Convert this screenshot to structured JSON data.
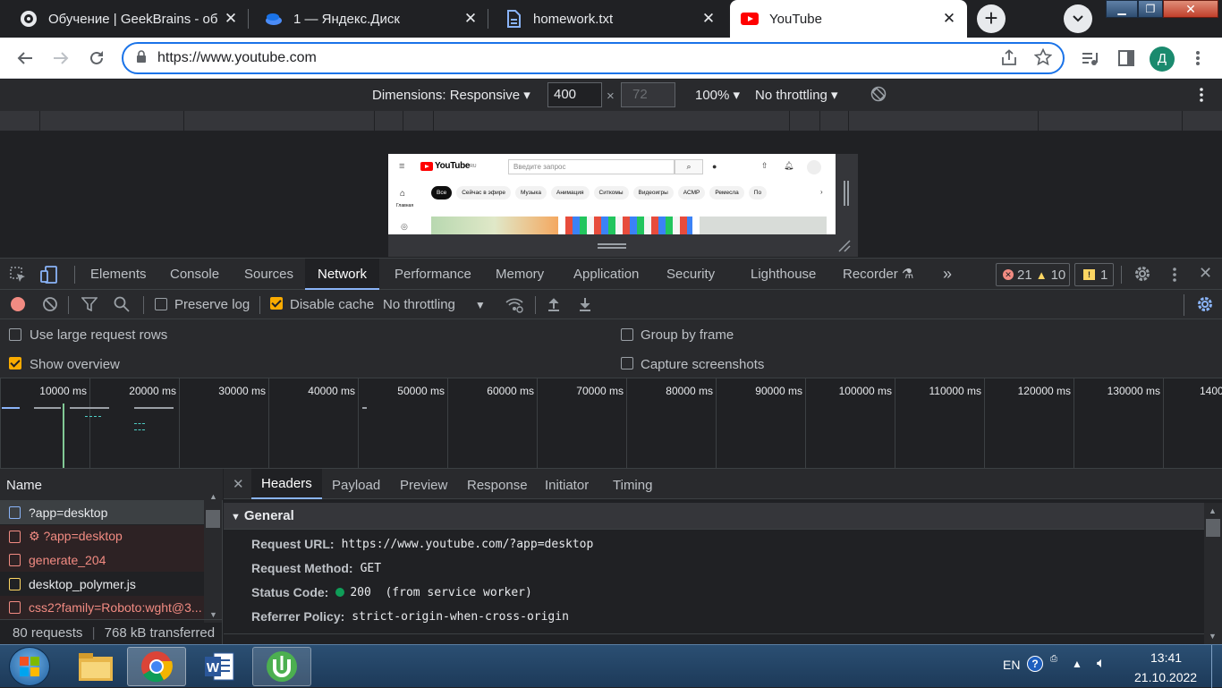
{
  "browser": {
    "tabs": [
      {
        "title": "Обучение | GeekBrains - об",
        "icon": "geekbrains-icon"
      },
      {
        "title": "1 — Яндекс.Диск",
        "icon": "yandex-disk-icon"
      },
      {
        "title": "homework.txt",
        "icon": "document-icon"
      },
      {
        "title": "YouTube",
        "icon": "youtube-icon"
      }
    ],
    "url": "https://www.youtube.com",
    "profile_letter": "Д"
  },
  "device_toolbar": {
    "dimensions": "Dimensions: Responsive",
    "width": "400",
    "height_placeholder": "72",
    "times": "×",
    "zoom": "100%",
    "throttling": "No throttling"
  },
  "preview": {
    "logo": "YouTube",
    "logo_sup": "RU",
    "search_placeholder": "Введите запрос",
    "home_label": "Главная",
    "chips": [
      "Все",
      "Сейчас в эфире",
      "Музыка",
      "Анимация",
      "Ситкомы",
      "Видеоигры",
      "АСМР",
      "Ремесла",
      "По"
    ]
  },
  "devtools": {
    "tabs": [
      "Elements",
      "Console",
      "Sources",
      "Network",
      "Performance",
      "Memory",
      "Application",
      "Security",
      "Lighthouse",
      "Recorder"
    ],
    "more": "»",
    "errors": "21",
    "warnings": "10",
    "issues": "1",
    "network_toolbar": {
      "preserve_log": "Preserve log",
      "disable_cache": "Disable cache",
      "throttling": "No throttling"
    },
    "settings": {
      "large_rows": "Use large request rows",
      "show_overview": "Show overview",
      "group_by_frame": "Group by frame",
      "capture_screenshots": "Capture screenshots"
    },
    "timeline_ticks": [
      "10000 ms",
      "20000 ms",
      "30000 ms",
      "40000 ms",
      "50000 ms",
      "60000 ms",
      "70000 ms",
      "80000 ms",
      "90000 ms",
      "100000 ms",
      "110000 ms",
      "120000 ms",
      "130000 ms",
      "1400"
    ],
    "name_header": "Name",
    "requests": [
      {
        "name": "?app=desktop",
        "status": "selected",
        "color": "#8ab4f8"
      },
      {
        "name": "⚙ ?app=desktop",
        "status": "error",
        "color": "#f28b82"
      },
      {
        "name": "generate_204",
        "status": "error",
        "color": "#f28b82"
      },
      {
        "name": "desktop_polymer.js",
        "status": "ok",
        "color": "#fdd663"
      },
      {
        "name": "css2?family=Roboto:wght@3...",
        "status": "error",
        "color": "#f28b82"
      }
    ],
    "summary_requests": "80 requests",
    "summary_transferred": "768 kB transferred",
    "detail_tabs": [
      "Headers",
      "Payload",
      "Preview",
      "Response",
      "Initiator",
      "Timing"
    ],
    "general_title": "General",
    "general": [
      {
        "key": "Request URL:",
        "value": "https://www.youtube.com/?app=desktop"
      },
      {
        "key": "Request Method:",
        "value": "GET"
      },
      {
        "key": "Status Code:",
        "value": "200  (from service worker)"
      },
      {
        "key": "Referrer Policy:",
        "value": "strict-origin-when-cross-origin"
      }
    ]
  },
  "taskbar": {
    "lang": "EN",
    "time": "13:41",
    "date": "21.10.2022"
  }
}
